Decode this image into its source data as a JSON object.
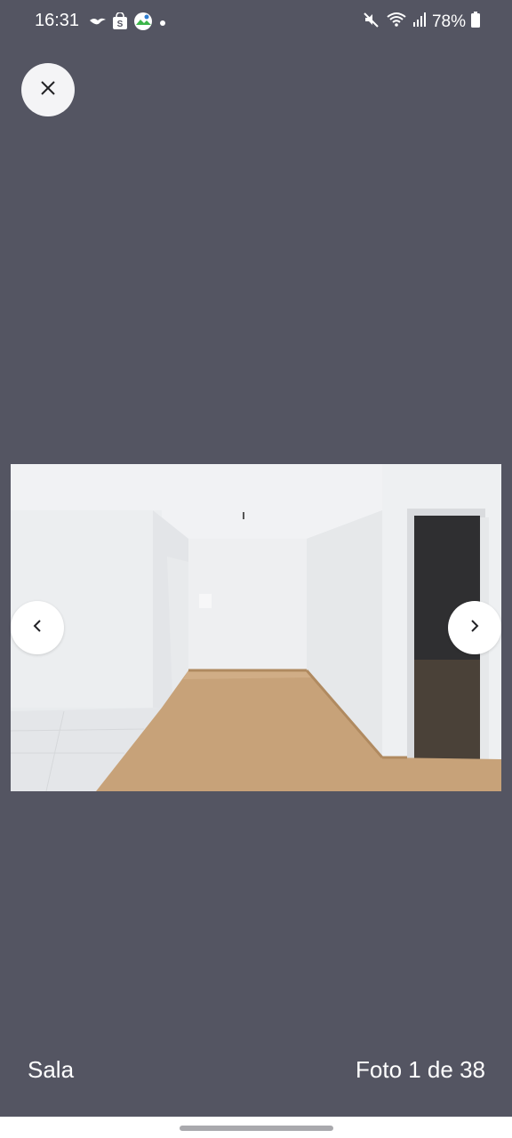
{
  "status_bar": {
    "time": "16:31",
    "battery": "78%",
    "left_icons": [
      "bird-notification-icon",
      "shopping-bag-icon",
      "photo-app-icon",
      "dot-icon"
    ],
    "right_icons": [
      "mute-icon",
      "wifi-icon",
      "signal-icon",
      "battery-icon"
    ]
  },
  "viewer": {
    "caption": "Sala",
    "counter": "Foto 1 de 38",
    "photo_alt": "Sala",
    "prev_icon": "chevron-left-icon",
    "next_icon": "chevron-right-icon",
    "close_icon": "close-icon"
  },
  "colors": {
    "background": "#545562",
    "button": "#f4f4f6",
    "text": "#ffffff"
  }
}
